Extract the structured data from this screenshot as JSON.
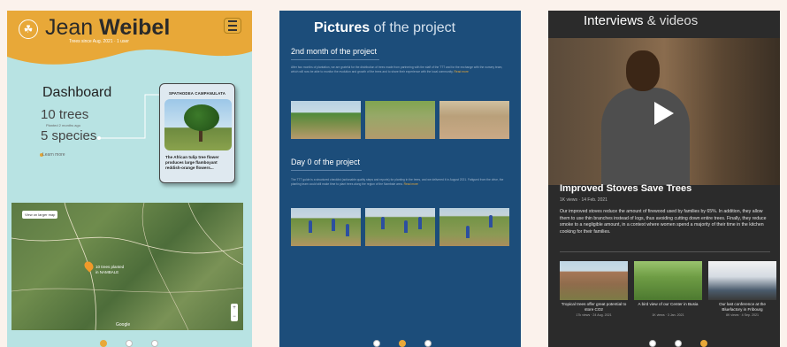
{
  "panel1": {
    "name_light": "Jean",
    "name_bold": "Weibel",
    "date_line": "Trees since Aug. 2021   ·   1 user",
    "dashboard_title": "Dashboard",
    "trees_stat": "10 trees",
    "trees_sub": "Planted 2 months ago",
    "species_stat": "5 species",
    "learn_more": "Learn more",
    "card": {
      "title": "SPATHODEA CAMPANULATA",
      "caption": "The African tulip tree flower produces large flamboyant reddish-orange flowers..."
    },
    "map": {
      "larger_map": "View on larger map",
      "label_line1": "10 trees planted",
      "label_line2": "in NAMBALE",
      "google": "Google",
      "zoom_in": "+",
      "zoom_out": "−"
    },
    "pager_active": 0
  },
  "panel2": {
    "title_bold": "Pictures",
    "title_rest": "of the project",
    "section1_title": "2nd month of the project",
    "section1_text": "After two months of plantation, we are grateful for the distribution of trees made from partnering with the staff of the TTT and for the exchange with the nursery team, which will now be able to monitor the evolution and growth of the trees and to share their experience with the local community.",
    "section2_title": "Day 0 of the project",
    "section2_text": "The TTT guide is a structured checklist (actionable quality steps and reports) for planting in the trees, and we delivered it in August 2021. Fatigued from the drive, the planting team could still make time to plant trees along the region of the Nambale area.",
    "read_more": "Read more",
    "pager_active": 1
  },
  "panel3": {
    "title_main": "Interviews",
    "title_rest": "& videos",
    "video_title": "Improved Stoves Save Trees",
    "video_meta": "1K views  ·  14 Feb. 2021",
    "video_desc": "Our improved stoves reduce the amount of firewood used by families by 65%. In addition, they allow them to use thin branches instead of logs, thus avoiding cutting down entire trees. Finally, they reduce smoke to a negligible amount, in a context where women spend a majority of their time in the kitchen cooking for their families.",
    "related": [
      {
        "caption": "Tropical trees offer great potential to store CO2",
        "meta": "17k views  ·  24 Aug. 2021"
      },
      {
        "caption": "A bird view of our Center in Busia",
        "meta": "1K views  ·  3 Jan. 2021"
      },
      {
        "caption": "Our last conference at the Bluefactory in Fribourg",
        "meta": "8K views  ·  4 Sep. 2021"
      }
    ],
    "pager_active": 2
  },
  "colors": {
    "accent": "#e8a838",
    "panel1_bg": "#b8e3e3",
    "panel2_bg": "#1c4d7a",
    "panel3_bg": "#2b2b2b"
  }
}
